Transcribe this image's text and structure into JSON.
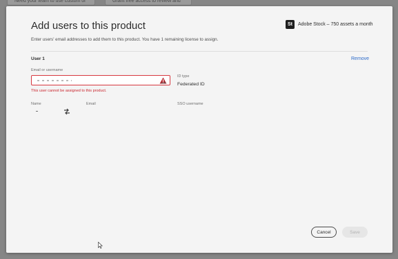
{
  "background": {
    "card_one_text": "Need your team to use custom or",
    "card_two_text": "Grant free access to review and"
  },
  "modal": {
    "title": "Add users to this product",
    "plan": {
      "logo_text": "St",
      "label": "Adobe Stock – 750 assets a month"
    },
    "subtitle": "Enter users' email addresses to add them to this product. You have 1 remaining license to assign.",
    "user": {
      "heading": "User 1",
      "remove_label": "Remove",
      "email_label": "Email or username",
      "error_text": "This user cannot be assigned to this product.",
      "id_type_label": "ID type",
      "id_type_value": "Federated ID",
      "columns": {
        "name": "Name",
        "email": "Email",
        "sso": "SSO username"
      },
      "row_name": "-"
    },
    "buttons": {
      "cancel": "Cancel",
      "save": "Save"
    }
  },
  "icons": {
    "alert": "alert-triangle-icon",
    "swap": "swap-arrows-icon",
    "cursor": "mouse-pointer-icon"
  },
  "colors": {
    "error": "#c9252d",
    "link": "#2d6bc9",
    "input_border_error": "#d7373f"
  }
}
